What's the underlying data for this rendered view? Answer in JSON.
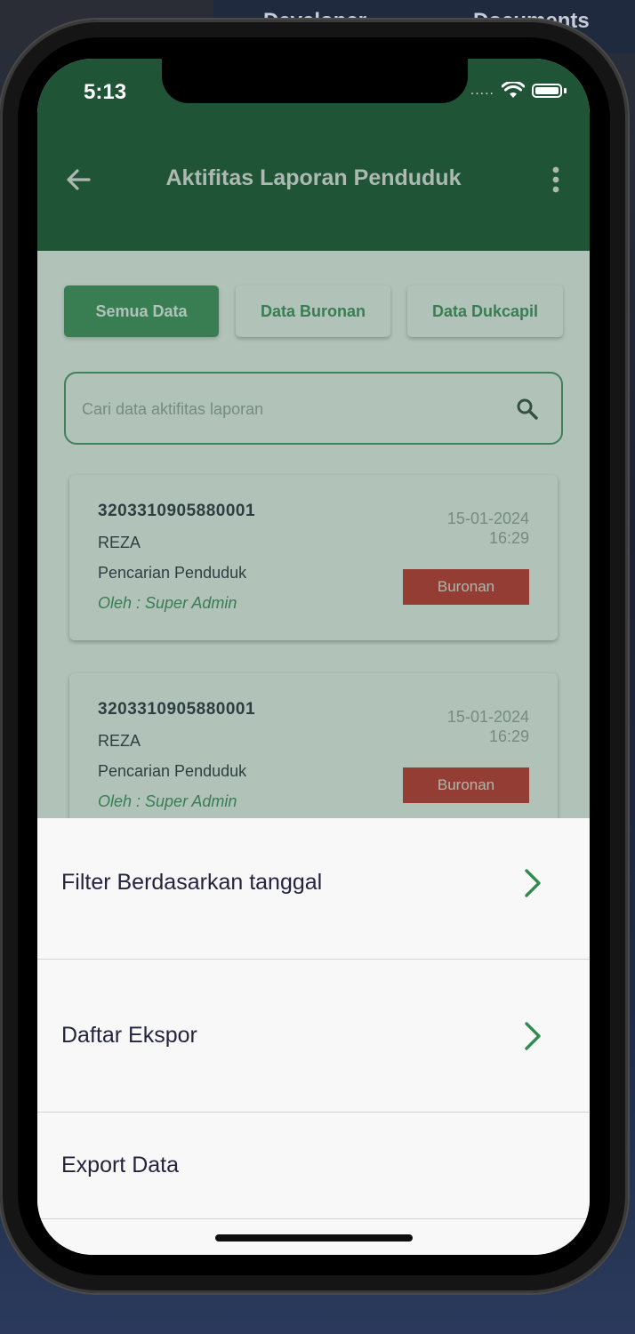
{
  "desktop": {
    "label_left": "Developer",
    "label_right": "Documents"
  },
  "status_bar": {
    "time": "5:13",
    "signal": "....."
  },
  "app_bar": {
    "title": "Aktifitas Laporan Penduduk",
    "back_icon": "arrow-left-icon",
    "menu_icon": "more-vertical-icon"
  },
  "filter_chips": [
    {
      "label": "Semua Data",
      "active": true
    },
    {
      "label": "Data Buronan",
      "active": false
    },
    {
      "label": "Data Dukcapil",
      "active": false
    }
  ],
  "search": {
    "placeholder": "Cari data aktifitas laporan",
    "icon": "search-icon"
  },
  "reports": [
    {
      "nik": "3203310905880001",
      "name": "REZA",
      "activity": "Pencarian Penduduk",
      "by": "Oleh : Super Admin",
      "date": "15-01-2024",
      "time": "16:29",
      "badge": "Buronan"
    },
    {
      "nik": "3203310905880001",
      "name": "REZA",
      "activity": "Pencarian Penduduk",
      "by": "Oleh : Super Admin",
      "date": "15-01-2024",
      "time": "16:29",
      "badge": "Buronan"
    }
  ],
  "bottom_sheet": {
    "items": [
      {
        "label": "Filter Berdasarkan tanggal",
        "icon": "chevron-right-icon"
      },
      {
        "label": "Daftar Ekspor",
        "icon": "chevron-right-icon"
      },
      {
        "label": "Export Data"
      }
    ]
  },
  "colors": {
    "primary": "#235e3c",
    "accent": "#2f8b4f",
    "badge_red": "#cc1b1b",
    "text_dark": "#24243e"
  }
}
